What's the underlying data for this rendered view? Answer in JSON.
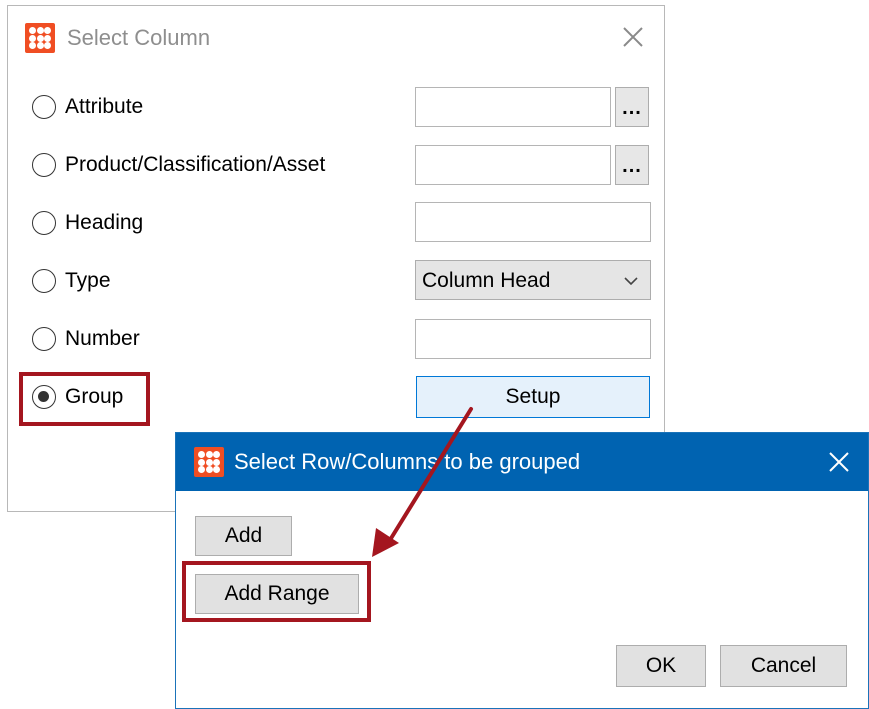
{
  "select_column_dialog": {
    "title": "Select Column",
    "options": [
      {
        "label": "Attribute",
        "selected": false
      },
      {
        "label": "Product/Classification/Asset",
        "selected": false
      },
      {
        "label": "Heading",
        "selected": false
      },
      {
        "label": "Type",
        "selected": false
      },
      {
        "label": "Number",
        "selected": false
      },
      {
        "label": "Group",
        "selected": true
      }
    ],
    "attribute_browse_label": "...",
    "product_browse_label": "...",
    "type_combo_value": "Column Head",
    "setup_label": "Setup"
  },
  "group_dialog": {
    "title": "Select Row/Columns to be grouped",
    "add_label": "Add",
    "add_range_label": "Add Range",
    "ok_label": "OK",
    "cancel_label": "Cancel"
  },
  "colors": {
    "accent": "#0063b1",
    "highlight": "#a4161f",
    "app_icon": "#f04e23"
  },
  "icons": [
    "app-icon",
    "close-icon",
    "chevron-down-icon",
    "radio-icon"
  ]
}
